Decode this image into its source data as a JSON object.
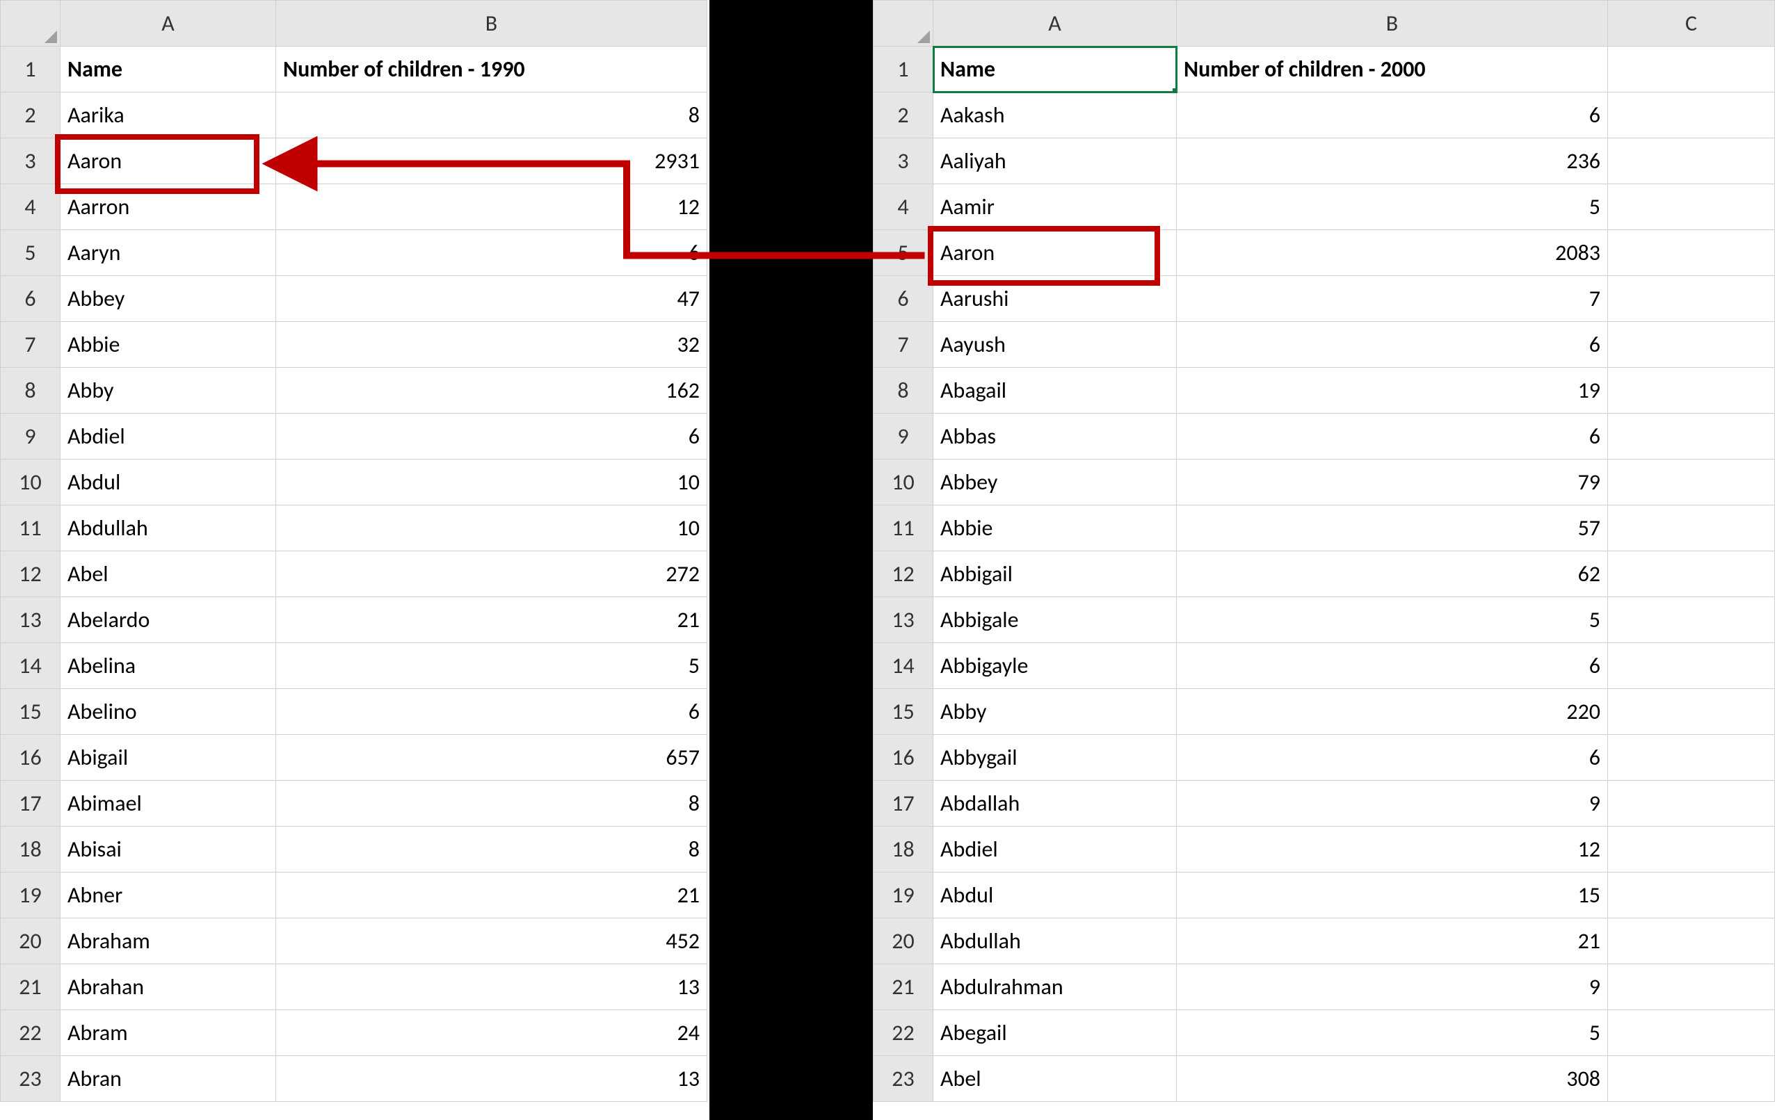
{
  "left": {
    "columns": [
      "A",
      "B"
    ],
    "header": {
      "A": "Name",
      "B": "Number of children - 1990"
    },
    "rows": [
      {
        "n": 1
      },
      {
        "n": 2,
        "name": "Aarika",
        "val": "8"
      },
      {
        "n": 3,
        "name": "Aaron",
        "val": "2931"
      },
      {
        "n": 4,
        "name": "Aarron",
        "val": "12"
      },
      {
        "n": 5,
        "name": "Aaryn",
        "val": "6"
      },
      {
        "n": 6,
        "name": "Abbey",
        "val": "47"
      },
      {
        "n": 7,
        "name": "Abbie",
        "val": "32"
      },
      {
        "n": 8,
        "name": "Abby",
        "val": "162"
      },
      {
        "n": 9,
        "name": "Abdiel",
        "val": "6"
      },
      {
        "n": 10,
        "name": "Abdul",
        "val": "10"
      },
      {
        "n": 11,
        "name": "Abdullah",
        "val": "10"
      },
      {
        "n": 12,
        "name": "Abel",
        "val": "272"
      },
      {
        "n": 13,
        "name": "Abelardo",
        "val": "21"
      },
      {
        "n": 14,
        "name": "Abelina",
        "val": "5"
      },
      {
        "n": 15,
        "name": "Abelino",
        "val": "6"
      },
      {
        "n": 16,
        "name": "Abigail",
        "val": "657"
      },
      {
        "n": 17,
        "name": "Abimael",
        "val": "8"
      },
      {
        "n": 18,
        "name": "Abisai",
        "val": "8"
      },
      {
        "n": 19,
        "name": "Abner",
        "val": "21"
      },
      {
        "n": 20,
        "name": "Abraham",
        "val": "452"
      },
      {
        "n": 21,
        "name": "Abrahan",
        "val": "13"
      },
      {
        "n": 22,
        "name": "Abram",
        "val": "24"
      },
      {
        "n": 23,
        "name": "Abran",
        "val": "13"
      }
    ]
  },
  "right": {
    "columns": [
      "A",
      "B",
      "C"
    ],
    "header": {
      "A": "Name",
      "B": "Number of children - 2000"
    },
    "active_cell": "A1",
    "rows": [
      {
        "n": 1
      },
      {
        "n": 2,
        "name": "Aakash",
        "val": "6"
      },
      {
        "n": 3,
        "name": "Aaliyah",
        "val": "236"
      },
      {
        "n": 4,
        "name": "Aamir",
        "val": "5"
      },
      {
        "n": 5,
        "name": "Aaron",
        "val": "2083"
      },
      {
        "n": 6,
        "name": "Aarushi",
        "val": "7"
      },
      {
        "n": 7,
        "name": "Aayush",
        "val": "6"
      },
      {
        "n": 8,
        "name": "Abagail",
        "val": "19"
      },
      {
        "n": 9,
        "name": "Abbas",
        "val": "6"
      },
      {
        "n": 10,
        "name": "Abbey",
        "val": "79"
      },
      {
        "n": 11,
        "name": "Abbie",
        "val": "57"
      },
      {
        "n": 12,
        "name": "Abbigail",
        "val": "62"
      },
      {
        "n": 13,
        "name": "Abbigale",
        "val": "5"
      },
      {
        "n": 14,
        "name": "Abbigayle",
        "val": "6"
      },
      {
        "n": 15,
        "name": "Abby",
        "val": "220"
      },
      {
        "n": 16,
        "name": "Abbygail",
        "val": "6"
      },
      {
        "n": 17,
        "name": "Abdallah",
        "val": "9"
      },
      {
        "n": 18,
        "name": "Abdiel",
        "val": "12"
      },
      {
        "n": 19,
        "name": "Abdul",
        "val": "15"
      },
      {
        "n": 20,
        "name": "Abdullah",
        "val": "21"
      },
      {
        "n": 21,
        "name": "Abdulrahman",
        "val": "9"
      },
      {
        "n": 22,
        "name": "Abegail",
        "val": "5"
      },
      {
        "n": 23,
        "name": "Abel",
        "val": "308"
      }
    ]
  },
  "annotation": {
    "highlight_name": "Aaron",
    "arrow_color": "#c00000"
  }
}
